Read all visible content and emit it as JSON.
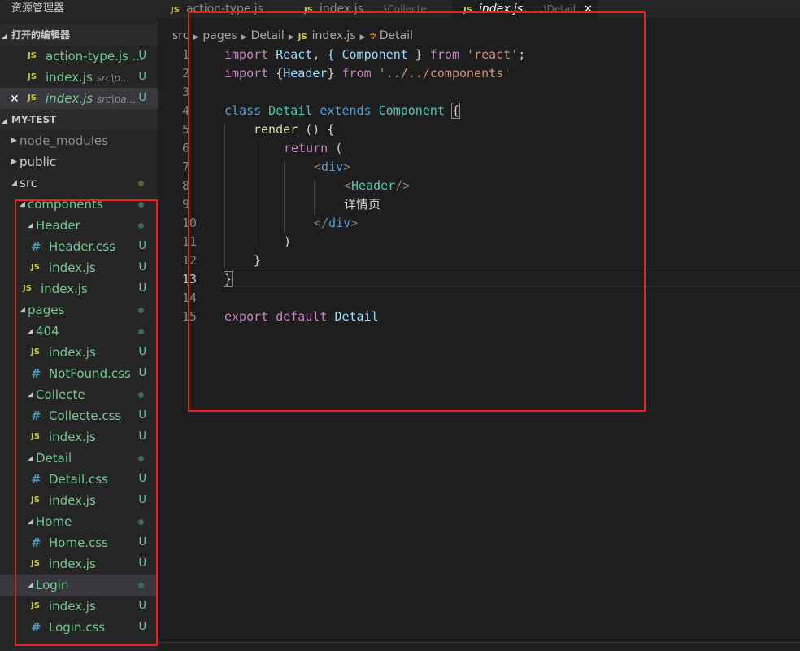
{
  "sidebar": {
    "title": "资源管理器",
    "open_editors": {
      "label": "打开的编辑器",
      "items": [
        {
          "name": "action-type.js ...",
          "desc": "",
          "badge": "U"
        },
        {
          "name": "index.js",
          "desc": "src\\p...",
          "badge": "U"
        },
        {
          "name": "index.js",
          "desc": "src\\pa...",
          "badge": "U"
        }
      ]
    },
    "project": {
      "label": "MY-TEST",
      "tree": [
        {
          "name": "node_modules"
        },
        {
          "name": "public"
        },
        {
          "name": "src"
        },
        {
          "name": "components"
        },
        {
          "name": "Header"
        },
        {
          "name": "Header.css",
          "badge": "U"
        },
        {
          "name": "index.js",
          "badge": "U"
        },
        {
          "name": "index.js",
          "badge": "U"
        },
        {
          "name": "pages"
        },
        {
          "name": "404"
        },
        {
          "name": "index.js",
          "badge": "U"
        },
        {
          "name": "NotFound.css",
          "badge": "U"
        },
        {
          "name": "Collecte"
        },
        {
          "name": "Collecte.css",
          "badge": "U"
        },
        {
          "name": "index.js",
          "badge": "U"
        },
        {
          "name": "Detail"
        },
        {
          "name": "Detail.css",
          "badge": "U"
        },
        {
          "name": "index.js",
          "badge": "U"
        },
        {
          "name": "Home"
        },
        {
          "name": "Home.css",
          "badge": "U"
        },
        {
          "name": "index.js",
          "badge": "U"
        },
        {
          "name": "Login"
        },
        {
          "name": "index.js",
          "badge": "U"
        },
        {
          "name": "Login.css",
          "badge": "U"
        }
      ]
    }
  },
  "tabs": [
    {
      "icon": "JS",
      "label": "action-type.js",
      "desc": ""
    },
    {
      "icon": "JS",
      "label": "index.js",
      "desc": "...\\Collecte"
    },
    {
      "icon": "JS",
      "label": "index.js",
      "desc": "...\\Detail",
      "close": "✕"
    }
  ],
  "breadcrumb": {
    "parts": [
      "src",
      "pages",
      "Detail"
    ],
    "file_icon": "JS",
    "file": "index.js",
    "symbol": "Detail"
  },
  "editor": {
    "line_numbers": [
      "1",
      "2",
      "3",
      "4",
      "5",
      "6",
      "7",
      "8",
      "9",
      "10",
      "11",
      "12",
      "13",
      "14",
      "15"
    ],
    "current_line": "13",
    "lines": {
      "l1": {
        "kw": "import",
        "a": " React, { ",
        "b": "Component",
        "c": " } ",
        "kw2": "from",
        "str": " 'react'",
        "end": ";"
      },
      "l2": {
        "kw": "import",
        "a": " {",
        "b": "Header",
        "c": "} ",
        "kw2": "from",
        "str": " '../../components'"
      },
      "l4": {
        "kw": "class",
        "name": " Detail ",
        "kw2": "extends",
        "base": " Component ",
        "brace": "{"
      },
      "l5": {
        "fn": "render",
        "rest": " () {"
      },
      "l6": {
        "kw": "return",
        "rest": " ("
      },
      "l7": {
        "open": "<",
        "tag": "div",
        "close": ">"
      },
      "l8": {
        "open": "<",
        "comp": "Header",
        "close": "/>"
      },
      "l9": {
        "text": "详情页"
      },
      "l10": {
        "open": "</",
        "tag": "div",
        "close": ">"
      },
      "l11": {
        "text": ")"
      },
      "l12": {
        "text": "}"
      },
      "l13": {
        "text": "}"
      },
      "l15": {
        "kw": "export",
        "kw2": " default",
        "name": " Detail"
      }
    }
  },
  "colors": {
    "annotation": "#e8231b",
    "untracked": "#73c991",
    "js_icon": "#cbcb41",
    "css_icon": "#519aba"
  }
}
